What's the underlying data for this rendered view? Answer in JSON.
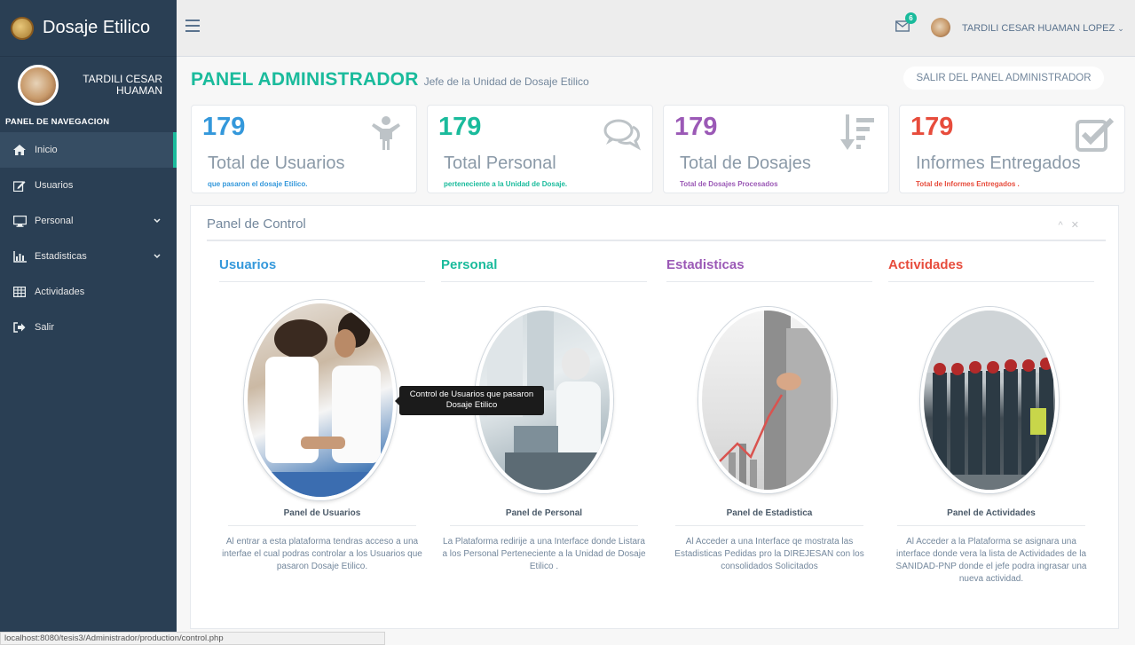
{
  "brand": {
    "name": "Dosaje Etilico"
  },
  "profile": {
    "name": "TARDILI CESAR HUAMAN"
  },
  "sidebar": {
    "title": "PANEL DE NAVEGACION",
    "items": [
      {
        "label": "Inicio",
        "icon": "home-icon"
      },
      {
        "label": "Usuarios",
        "icon": "edit-icon"
      },
      {
        "label": "Personal",
        "icon": "desktop-icon"
      },
      {
        "label": "Estadisticas",
        "icon": "bar-chart-icon"
      },
      {
        "label": "Actividades",
        "icon": "table-icon"
      },
      {
        "label": "Salir",
        "icon": "sign-out-icon"
      }
    ]
  },
  "topbar": {
    "mail_count": "6",
    "user": "TARDILI CESAR HUAMAN LOPEZ"
  },
  "header": {
    "title": "PANEL ADMINISTRADOR",
    "subtitle": "Jefe de la Unidad de Dosaje Etilico",
    "exit_button": "SALIR DEL PANEL ADMINISTRADOR"
  },
  "tiles": [
    {
      "count": "179",
      "label": "Total de Usuarios",
      "desc": "que pasaron el dosaje Etilico.",
      "color": "#3498db",
      "icon": "child-icon"
    },
    {
      "count": "179",
      "label": "Total Personal",
      "desc": "perteneciente a la Unidad de Dosaje.",
      "color": "#1abb9c",
      "icon": "comments-icon"
    },
    {
      "count": "179",
      "label": "Total de Dosajes",
      "desc": "Total de Dosajes Procesados",
      "color": "#9b59b6",
      "icon": "sort-amount-icon"
    },
    {
      "count": "179",
      "label": "Informes Entregados",
      "desc": "Total de Informes Entregados .",
      "color": "#e74c3c",
      "icon": "check-square-icon"
    }
  ],
  "panel": {
    "title": "Panel de Control",
    "columns": [
      {
        "heading": "Usuarios",
        "color": "#3498db",
        "card_title": "Panel de Usuarios",
        "text": "Al entrar a esta plataforma tendras acceso a una interfae el cual podras controlar a los Usuarios que pasaron Dosaje Etilico."
      },
      {
        "heading": "Personal",
        "color": "#1abb9c",
        "card_title": "Panel de Personal",
        "text": "La Plataforma redirije a una Interface donde Listara a los Personal Perteneciente a la Unidad de Dosaje Etilico ."
      },
      {
        "heading": "Estadisticas",
        "color": "#9b59b6",
        "card_title": "Panel de Estadistica",
        "text": "Al Acceder a una Interface qe mostrata las Estadisticas Pedidas pro la DIREJESAN con los consolidados Solicitados"
      },
      {
        "heading": "Actividades",
        "color": "#e74c3c",
        "card_title": "Panel de Actividades",
        "text": "Al Acceder a la Plataforma se asignara una interface donde vera la lista de Actividades de la SANIDAD-PNP donde el jefe podra ingrasar una nueva actividad."
      }
    ]
  },
  "tooltip": "Control de Usuarios que pasaron Dosaje Etilico",
  "statusbar": "localhost:8080/tesis3/Administrador/production/control.php"
}
